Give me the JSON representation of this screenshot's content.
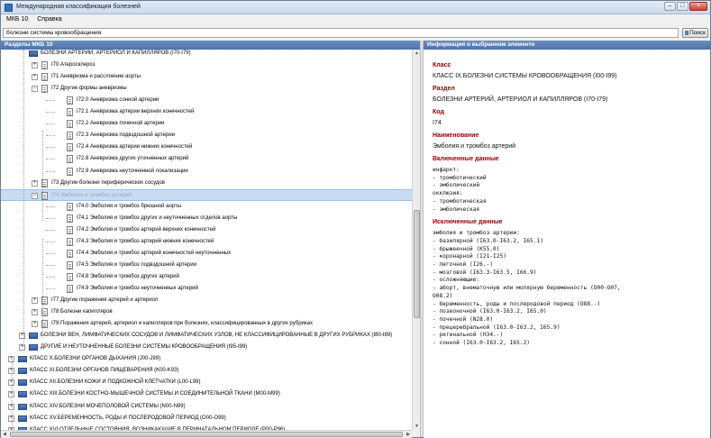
{
  "window": {
    "title": "Международная классификация болезней",
    "min_icon": "minimize-icon",
    "max_icon": "maximize-icon",
    "close_icon": "close-icon"
  },
  "menu": [
    "МКБ 10",
    "Справка"
  ],
  "search": {
    "value": "болезни системы кровообращения",
    "button_label": "Поиск"
  },
  "panels": {
    "left_title": "Разделы МКБ 10",
    "right_title": "Информация о выбранном элементе"
  },
  "tree": [
    {
      "label": "БОЛЕЗНИ АРТЕРИЙ, АРТЕРИОЛ И КАПИЛЛЯРОВ (I70-I79)",
      "level": 1,
      "type": "book",
      "expander": "",
      "clipped": true
    },
    {
      "label": "I70 Атеросклероз",
      "level": 2,
      "type": "doc",
      "expander": "+"
    },
    {
      "label": "I71 Аневризма и расслоение аорты",
      "level": 2,
      "type": "doc",
      "expander": "+"
    },
    {
      "label": "I72 Другие формы аневризмы",
      "level": 2,
      "type": "doc",
      "expander": "-"
    },
    {
      "label": "I72.0 Аневризма сонной артерии",
      "level": 3,
      "type": "doc",
      "expander": ""
    },
    {
      "label": "I72.1 Аневризма артерии верхних конечностей",
      "level": 3,
      "type": "doc",
      "expander": ""
    },
    {
      "label": "I72.2 Аневризма почечной артерии",
      "level": 3,
      "type": "doc",
      "expander": ""
    },
    {
      "label": "I72.3 Аневризма подвздошной артерии",
      "level": 3,
      "type": "doc",
      "expander": ""
    },
    {
      "label": "I72.4 Аневризма артерии нижних конечностей",
      "level": 3,
      "type": "doc",
      "expander": ""
    },
    {
      "label": "I72.8 Аневризма других уточненных артерий",
      "level": 3,
      "type": "doc",
      "expander": ""
    },
    {
      "label": "I72.9 Аневризма неуточненной локализации",
      "level": 3,
      "type": "doc",
      "expander": ""
    },
    {
      "label": "I73 Другие болезни периферических сосудов",
      "level": 2,
      "type": "doc",
      "expander": "+"
    },
    {
      "label": "I74 Эмболия и тромбоз артерий",
      "level": 2,
      "type": "doc",
      "expander": "-",
      "selected": true
    },
    {
      "label": "I74.0 Эмболия и тромбоз брюшной аорты",
      "level": 3,
      "type": "doc",
      "expander": ""
    },
    {
      "label": "I74.1 Эмболия и тромбоз других и неуточненных отделов аорты",
      "level": 3,
      "type": "doc",
      "expander": ""
    },
    {
      "label": "I74.2 Эмболия и тромбоз артерий верхних конечностей",
      "level": 3,
      "type": "doc",
      "expander": ""
    },
    {
      "label": "I74.3 Эмболия и тромбоз артерий нижних конечностей",
      "level": 3,
      "type": "doc",
      "expander": ""
    },
    {
      "label": "I74.4 Эмболия и тромбоз артерий конечностей неуточненных",
      "level": 3,
      "type": "doc",
      "expander": ""
    },
    {
      "label": "I74.5 Эмболия и тромбоз подвздошной артерии",
      "level": 3,
      "type": "doc",
      "expander": ""
    },
    {
      "label": "I74.8 Эмболия и тромбоз других артерий",
      "level": 3,
      "type": "doc",
      "expander": ""
    },
    {
      "label": "I74.9 Эмболия и тромбоз неуточненных артерий",
      "level": 3,
      "type": "doc",
      "expander": ""
    },
    {
      "label": "I77 Другие поражения артерий и артериол",
      "level": 2,
      "type": "doc",
      "expander": "+"
    },
    {
      "label": "I78 Болезни капилляров",
      "level": 2,
      "type": "doc",
      "expander": "+"
    },
    {
      "label": "I79 Поражения артерий, артериол и капилляров при болезнях, классифицированных в других рубриках",
      "level": 2,
      "type": "doc",
      "expander": "+"
    },
    {
      "label": "БОЛЕЗНИ ВЕН, ЛИМФАТИЧЕСКИХ СОСУДОВ И ЛИМФАТИЧЕСКИХ УЗЛОВ, НЕ КЛАССИФИЦИРОВАННЫЕ В ДРУГИХ РУБРИКАХ (I80-I89)",
      "level": 1,
      "type": "book",
      "expander": "+"
    },
    {
      "label": "ДРУГИЕ И НЕУТОЧНЕННЫЕ БОЛЕЗНИ СИСТЕМЫ КРОВООБРАЩЕНИЯ (I95-I99)",
      "level": 1,
      "type": "book",
      "expander": "+"
    },
    {
      "label": "КЛАСС X.БОЛЕЗНИ ОРГАНОВ ДЫХАНИЯ (J00-J99)",
      "level": 0,
      "type": "book",
      "expander": "+"
    },
    {
      "label": "КЛАСС XI.БОЛЕЗНИ ОРГАНОВ ПИЩЕВАРЕНИЯ (K00-K93)",
      "level": 0,
      "type": "book",
      "expander": "+"
    },
    {
      "label": "КЛАСС XII.БОЛЕЗНИ КОЖИ И ПОДКОЖНОЙ КЛЕТЧАТКИ (L00-L99)",
      "level": 0,
      "type": "book",
      "expander": "+"
    },
    {
      "label": "КЛАСС XIII.БОЛЕЗНИ КОСТНО-МЫШЕЧНОЙ СИСТЕМЫ И СОЕДИНИТЕЛЬНОЙ ТКАНИ (M00-M99)",
      "level": 0,
      "type": "book",
      "expander": "+"
    },
    {
      "label": "КЛАСС XIV.БОЛЕЗНИ МОЧЕПОЛОВОЙ СИСТЕМЫ (N00-N99)",
      "level": 0,
      "type": "book",
      "expander": "+"
    },
    {
      "label": "КЛАСС XV.БЕРЕМЕННОСТЬ, РОДЫ И ПОСЛЕРОДОВОЙ ПЕРИОД (O00-O99)",
      "level": 0,
      "type": "book",
      "expander": "+"
    },
    {
      "label": "КЛАСС XVI.ОТДЕЛЬНЫЕ СОСТОЯНИЯ, ВОЗНИКАЮЩИЕ В ПЕРИНАТАЛЬНОМ ПЕРИОДЕ (P00-P96)",
      "level": 0,
      "type": "book",
      "expander": "+"
    }
  ],
  "info": {
    "class_title": "Класс",
    "class_value": "КЛАСС IX.БОЛЕЗНИ СИСТЕМЫ КРОВООБРАЩЕНИЯ (I00-I99)",
    "section_title": "Раздел",
    "section_value": "БОЛЕЗНИ АРТЕРИЙ, АРТЕРИОЛ И КАПИЛЛЯРОВ (I70-I79)",
    "code_title": "Код",
    "code_value": "I74",
    "name_title": "Наименование",
    "name_value": "Эмболия и тромбоз артерий",
    "included_title": "Включенные данные",
    "included_text": "инфаркт:\n- тромботический\n- эмболический\nокклюзия:\n- тромботическая\n- эмболическая",
    "excluded_title": "Исключенные данные",
    "excluded_text": "эмболия и тромбоз артерии:\n- базилярной (I63.0-I63.2, I65.1)\n- брыжеечной (K55.0)\n- коронарной (I21-I25)\n- легочной (I26.-)\n- мозговой (I63.3-I63.5, I66.9)\n- осложняющие:\n- аборт, внематочную или молярную беременность (O00-O07,\nO08.2)\n- беременность, роды и послеродовой период (O88.-)\n- позвоночной (I63.0-I63.2, I65.0)\n- почечной (N28.0)\n- прецеребральной (I63.0-I63.2, I65.9)\n- ретинальной (H34.-)\n- сонной (I63.0-I63.2, I65.2)"
  }
}
